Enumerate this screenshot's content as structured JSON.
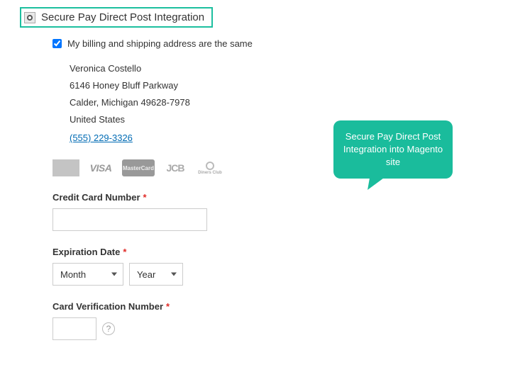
{
  "payment_method": {
    "title": "Secure Pay Direct Post Integration"
  },
  "same_address": {
    "label": "My billing and shipping address are the same",
    "checked": true
  },
  "address": {
    "name": "Veronica Costello",
    "street": "6146 Honey Bluff Parkway",
    "city_state_zip": "Calder, Michigan 49628-7978",
    "country": "United States",
    "phone": "(555) 229-3326"
  },
  "card_logos": {
    "visa": "VISA",
    "mastercard": "MasterCard",
    "jcb": "JCB",
    "diners": "Diners Club"
  },
  "fields": {
    "cc_number_label": "Credit Card Number",
    "exp_label": "Expiration Date",
    "month_placeholder": "Month",
    "year_placeholder": "Year",
    "cvv_label": "Card Verification Number",
    "help_glyph": "?"
  },
  "callout": {
    "text": "Secure Pay Direct Post Integration into Magento site"
  }
}
